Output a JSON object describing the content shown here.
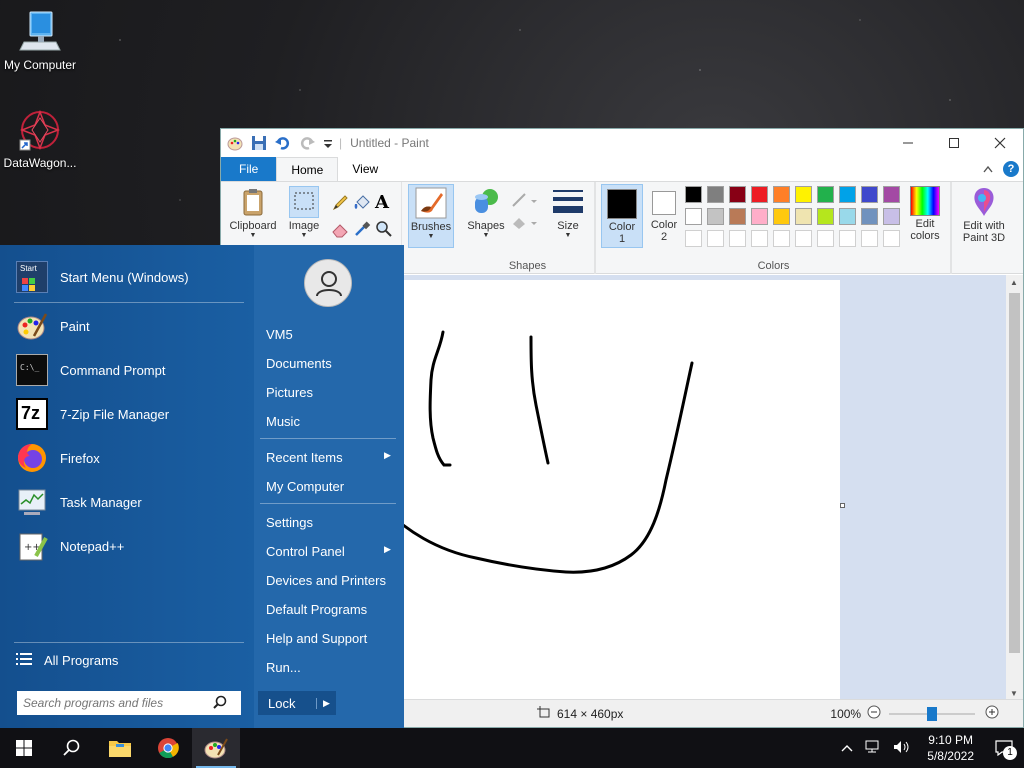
{
  "desktop": {
    "icons": [
      {
        "label": "My Computer"
      },
      {
        "label": "DataWagon..."
      }
    ]
  },
  "paint": {
    "title": "Untitled - Paint",
    "tabs": [
      "File",
      "Home",
      "View"
    ],
    "ribbon": {
      "clipboard": "Clipboard",
      "image": "Image",
      "brushes": "Brushes",
      "shapes": "Shapes",
      "shapes_group": "Shapes",
      "size": "Size",
      "color1": "Color\n1",
      "color1_a": "Color",
      "color1_b": "1",
      "color2_a": "Color",
      "color2_b": "2",
      "colors_group": "Colors",
      "edit_colors_a": "Edit",
      "edit_colors_b": "colors",
      "edit3d_a": "Edit with",
      "edit3d_b": "Paint 3D"
    },
    "palette_row1": [
      "#000000",
      "#7f7f7f",
      "#880015",
      "#ed1c24",
      "#ff7f27",
      "#fff200",
      "#22b14c",
      "#00a2e8",
      "#3f48cc",
      "#a349a4"
    ],
    "palette_row2": [
      "#ffffff",
      "#c3c3c3",
      "#b97a57",
      "#ffaec9",
      "#ffc90e",
      "#efe4b0",
      "#b5e61d",
      "#99d9ea",
      "#7092be",
      "#c8bfe7"
    ],
    "color1_value": "#000000",
    "color2_value": "#ffffff",
    "status": {
      "dimensions": "614 × 460px",
      "zoom": "100%",
      "zoom_level": 0.5
    }
  },
  "start_menu": {
    "pinned": [
      {
        "label": "Start Menu (Windows)",
        "icon": "start-menu-icon"
      },
      {
        "label": "Paint",
        "icon": "paint-icon"
      },
      {
        "label": "Command Prompt",
        "icon": "cmd-icon"
      },
      {
        "label": "7-Zip File Manager",
        "icon": "7zip-icon"
      },
      {
        "label": "Firefox",
        "icon": "firefox-icon"
      },
      {
        "label": "Task Manager",
        "icon": "task-manager-icon"
      },
      {
        "label": "Notepad++",
        "icon": "notepadpp-icon"
      }
    ],
    "all_programs": "All Programs",
    "search_placeholder": "Search programs and files",
    "right": {
      "user": "VM5",
      "documents": "Documents",
      "pictures": "Pictures",
      "music": "Music",
      "recent": "Recent Items",
      "computer": "My Computer",
      "settings": "Settings",
      "control_panel": "Control Panel",
      "devices": "Devices and Printers",
      "default_programs": "Default Programs",
      "help": "Help and Support",
      "run": "Run..."
    },
    "lock": "Lock",
    "start_logo_text": "Start"
  },
  "taskbar": {
    "time": "9:10 PM",
    "date": "5/8/2022",
    "notification_count": "1"
  }
}
